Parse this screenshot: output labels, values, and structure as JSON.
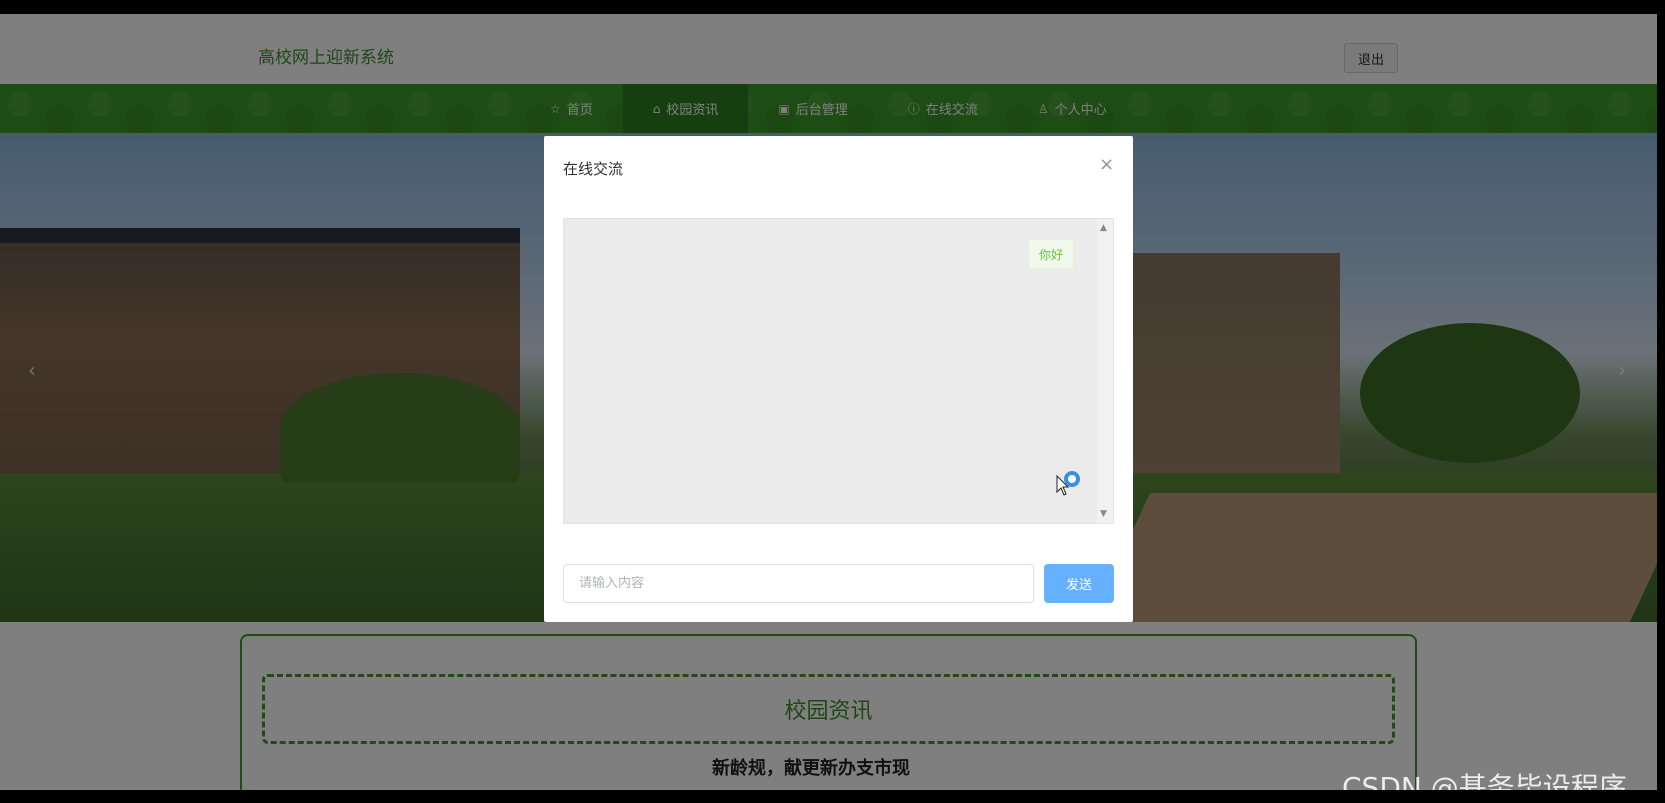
{
  "header": {
    "site_title": "高校网上迎新系统",
    "logout_label": "退出"
  },
  "nav": {
    "items": [
      {
        "icon": "star-icon",
        "glyph": "☆",
        "label": "首页"
      },
      {
        "icon": "bag-icon",
        "glyph": "⌂",
        "label": "校园资讯"
      },
      {
        "icon": "box-icon",
        "glyph": "▣",
        "label": "后台管理"
      },
      {
        "icon": "info-icon",
        "glyph": "ⓘ",
        "label": "在线交流"
      },
      {
        "icon": "user-icon",
        "glyph": "♙",
        "label": "个人中心"
      }
    ],
    "active_index": 1
  },
  "banner": {
    "prev_glyph": "‹",
    "next_glyph": "›"
  },
  "news": {
    "title": "校园资讯",
    "subtitle": "新龄规，献更新办支市现"
  },
  "modal": {
    "title": "在线交流",
    "close_glyph": "×",
    "messages": [
      {
        "text": "你好",
        "side": "right"
      }
    ],
    "input_placeholder": "请输入内容",
    "input_value": "",
    "send_label": "发送",
    "scroll_up_glyph": "▲",
    "scroll_down_glyph": "▼"
  },
  "watermark": "CSDN @基务毕设程序",
  "colors": {
    "brand_green": "#3a9a28",
    "send_blue": "#66b1ff",
    "bubble_green": "#67c23a"
  }
}
